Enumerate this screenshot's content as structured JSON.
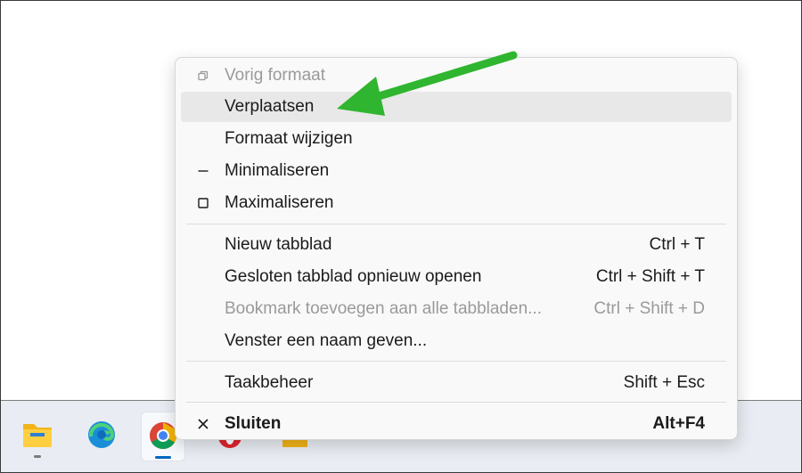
{
  "menu": {
    "items": [
      {
        "label": "Vorig formaat",
        "shortcut": "",
        "icon": "restore-icon",
        "disabled": true
      },
      {
        "label": "Verplaatsen",
        "shortcut": "",
        "icon": "",
        "disabled": false,
        "hovered": true
      },
      {
        "label": "Formaat wijzigen",
        "shortcut": "",
        "icon": "",
        "disabled": false
      },
      {
        "label": "Minimaliseren",
        "shortcut": "",
        "icon": "minimize-icon",
        "disabled": false
      },
      {
        "label": "Maximaliseren",
        "shortcut": "",
        "icon": "maximize-icon",
        "disabled": false
      },
      {
        "label": "Nieuw tabblad",
        "shortcut": "Ctrl + T",
        "disabled": false
      },
      {
        "label": "Gesloten tabblad opnieuw openen",
        "shortcut": "Ctrl + Shift + T",
        "disabled": false
      },
      {
        "label": "Bookmark toevoegen aan alle tabbladen...",
        "shortcut": "Ctrl + Shift + D",
        "disabled": true
      },
      {
        "label": "Venster een naam geven...",
        "shortcut": "",
        "disabled": false
      },
      {
        "label": "Taakbeheer",
        "shortcut": "Shift + Esc",
        "disabled": false
      },
      {
        "label": "Sluiten",
        "shortcut": "Alt+F4",
        "icon": "close-icon",
        "disabled": false,
        "bold": true
      }
    ]
  },
  "taskbar": {
    "apps": [
      {
        "name": "File Explorer",
        "icon": "folder-icon"
      },
      {
        "name": "Microsoft Edge",
        "icon": "edge-icon"
      },
      {
        "name": "Google Chrome",
        "icon": "chrome-icon",
        "active": true
      },
      {
        "name": "Opera",
        "icon": "opera-icon"
      },
      {
        "name": "Folder",
        "icon": "folder-icon"
      }
    ]
  },
  "colors": {
    "annotation_arrow": "#2fb52f",
    "menu_bg": "#f9f9f9",
    "hover_bg": "#e8e8e8",
    "disabled_text": "#9a9a9a",
    "taskbar_bg": "#e9edf3"
  }
}
